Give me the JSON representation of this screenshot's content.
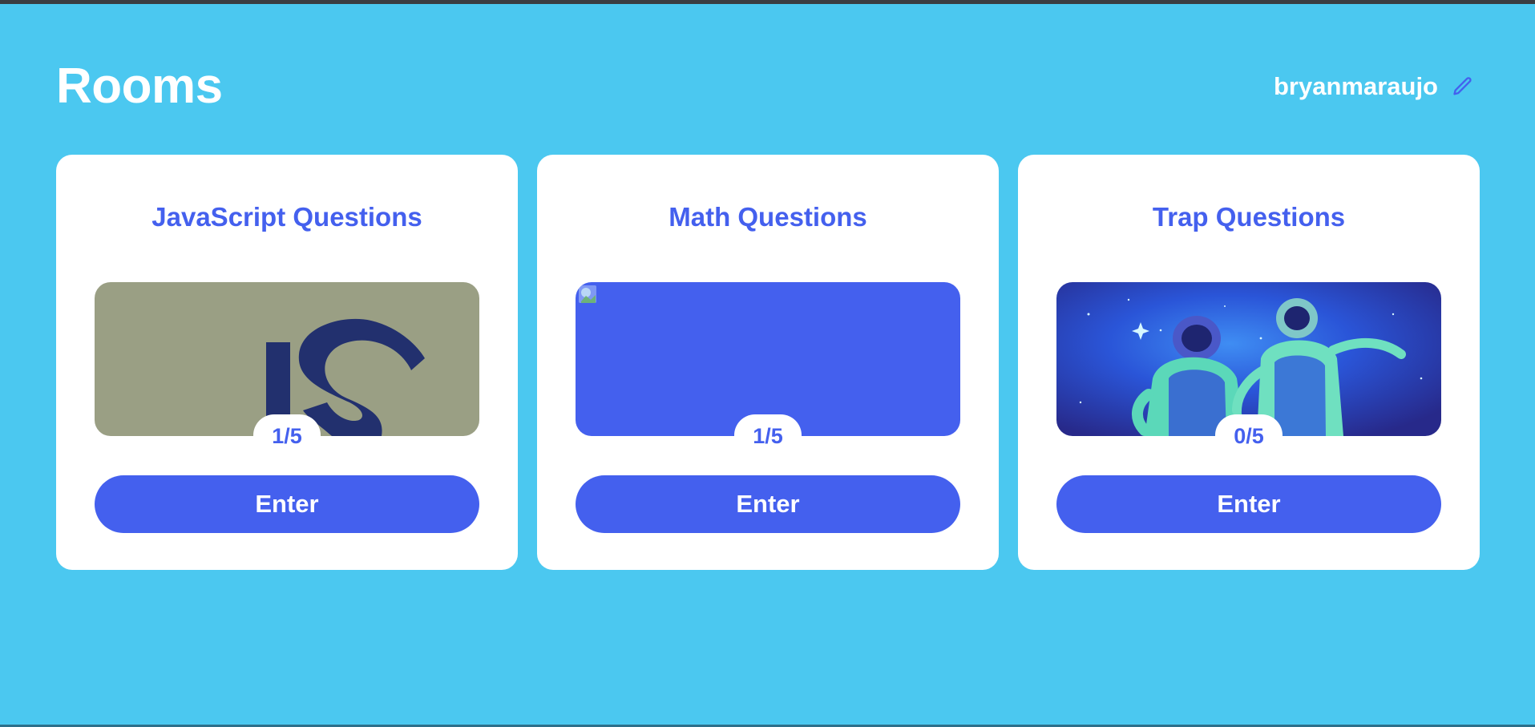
{
  "page": {
    "title": "Rooms"
  },
  "user": {
    "username": "bryanmaraujo",
    "edit_icon": "pencil-icon"
  },
  "rooms": [
    {
      "title": "JavaScript Questions",
      "progress": "1/5",
      "image": "javascript-logo",
      "enter_label": "Enter"
    },
    {
      "title": "Math Questions",
      "progress": "1/5",
      "image": "broken-image",
      "enter_label": "Enter"
    },
    {
      "title": "Trap Questions",
      "progress": "0/5",
      "image": "astronauts",
      "enter_label": "Enter"
    }
  ],
  "colors": {
    "background": "#4bc8f0",
    "accent": "#4460ee",
    "card": "#ffffff"
  }
}
